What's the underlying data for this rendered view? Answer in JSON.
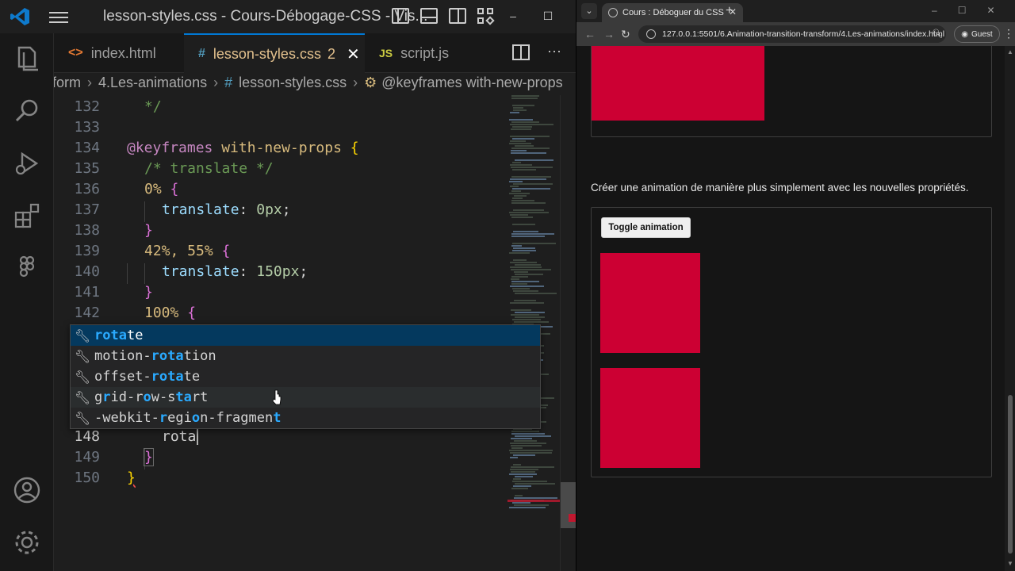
{
  "colors": {
    "accent": "#0078d4",
    "red_box": "#cc0033",
    "modified_tab": "#e2c08d"
  },
  "vscode": {
    "window_title": "lesson-styles.css - Cours-Débogage-CSS - Vis...",
    "tabs": [
      {
        "icon": "<>",
        "label": "index.html",
        "badge": "",
        "active": false
      },
      {
        "icon": "#",
        "label": "lesson-styles.css",
        "badge": "2",
        "active": true
      },
      {
        "icon": "JS",
        "label": "script.js",
        "badge": "",
        "active": false
      }
    ],
    "breadcrumb": [
      "form",
      "4.Les-animations",
      "lesson-styles.css",
      "@keyframes with-new-props"
    ],
    "lines": [
      {
        "num": "132",
        "indent": 1,
        "text": "*/"
      },
      {
        "num": "133",
        "indent": 0,
        "text": ""
      },
      {
        "num": "134",
        "indent": 0,
        "text": "@keyframes with-new-props {"
      },
      {
        "num": "135",
        "indent": 1,
        "text": "/* translate */"
      },
      {
        "num": "136",
        "indent": 1,
        "text": "0% {"
      },
      {
        "num": "137",
        "indent": 2,
        "text": "translate: 0px;"
      },
      {
        "num": "138",
        "indent": 1,
        "text": "}"
      },
      {
        "num": "139",
        "indent": 1,
        "text": "42%, 55% {"
      },
      {
        "num": "140",
        "indent": 2,
        "text": "translate: 150px;"
      },
      {
        "num": "141",
        "indent": 1,
        "text": "}"
      },
      {
        "num": "142",
        "indent": 1,
        "text": "100% {"
      },
      {
        "num": "148",
        "indent": 2,
        "text": "rota"
      },
      {
        "num": "149",
        "indent": 1,
        "text": "}"
      },
      {
        "num": "150",
        "indent": 0,
        "text": "}"
      }
    ],
    "suggestions": [
      {
        "label": "rotate",
        "match": "rota",
        "selected": true
      },
      {
        "label": "motion-rotation",
        "match": "",
        "selected": false
      },
      {
        "label": "offset-rotate",
        "match": "",
        "selected": false
      },
      {
        "label": "grid-row-start",
        "match": "",
        "selected": false
      },
      {
        "label": "-webkit-region-fragment",
        "match": "",
        "selected": false
      }
    ],
    "activity_icons": [
      "explorer-icon",
      "search-icon",
      "run-debug-icon",
      "extensions-icon",
      "figma-icon",
      "account-icon",
      "settings-gear-icon"
    ]
  },
  "browser": {
    "tab_title": "Cours : Déboguer du CSS",
    "url": "127.0.0.1:5501/6.Animation-transition-transform/4.Les-animations/index.html",
    "profile": "Guest",
    "description": "Créer une animation de manière plus simplement avec les nouvelles propriétés.",
    "toggle_button": "Toggle animation"
  }
}
